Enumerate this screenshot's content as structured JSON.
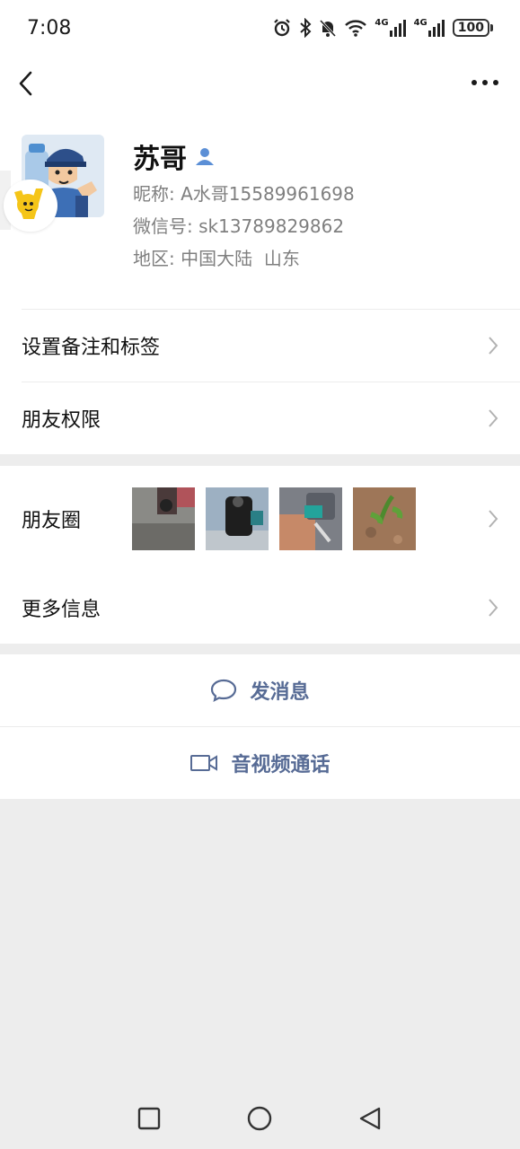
{
  "status_bar": {
    "time": "7:08",
    "battery": "100",
    "signal_label_1": "4G",
    "signal_label_2": "4G"
  },
  "profile": {
    "name": "苏哥",
    "nickname_label": "昵称: ",
    "nickname": "A水哥15589961698",
    "wechat_id_label": "微信号: ",
    "wechat_id": "sk13789829862",
    "region_label": "地区: ",
    "region": "中国大陆  山东"
  },
  "menu": {
    "remark_tags": "设置备注和标签",
    "friend_permissions": "朋友权限",
    "moments": "朋友圈",
    "more_info": "更多信息"
  },
  "actions": {
    "send_message": "发消息",
    "video_call": "音视频通话"
  },
  "colors": {
    "link_blue": "#576b95",
    "bg_gray": "#ededed"
  }
}
